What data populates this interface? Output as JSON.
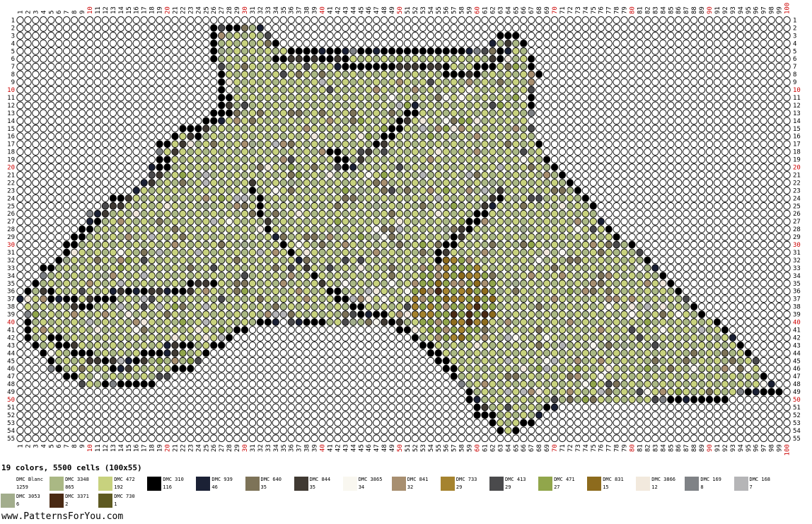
{
  "pattern": {
    "columns": 100,
    "rows": 55,
    "summary": "19 colors, 5500 cells (100x55)",
    "website": "www.PatternsForYou.com",
    "highlight_color": "#cc0000",
    "grid_line_color": "#000000"
  },
  "legend": [
    {
      "name": "DMC Blanc",
      "count": "1259",
      "color": "#ffffff"
    },
    {
      "name": "DMC 3348",
      "count": "865",
      "color": "#aab884"
    },
    {
      "name": "DMC 472",
      "count": "192",
      "color": "#c8d27e"
    },
    {
      "name": "DMC 310",
      "count": "116",
      "color": "#000000"
    },
    {
      "name": "DMC 939",
      "count": "46",
      "color": "#1b2135"
    },
    {
      "name": "DMC 640",
      "count": "35",
      "color": "#7d7358"
    },
    {
      "name": "DMC 844",
      "count": "35",
      "color": "#403a33"
    },
    {
      "name": "DMC 3865",
      "count": "34",
      "color": "#f9f7f0"
    },
    {
      "name": "DMC 841",
      "count": "32",
      "color": "#a88f70"
    },
    {
      "name": "DMC 733",
      "count": "29",
      "color": "#a5832f"
    },
    {
      "name": "DMC 413",
      "count": "29",
      "color": "#4a4a4c"
    },
    {
      "name": "DMC 471",
      "count": "27",
      "color": "#91a64b"
    },
    {
      "name": "DMC 831",
      "count": "15",
      "color": "#8d6b1d"
    },
    {
      "name": "DMC 3866",
      "count": "12",
      "color": "#f2e9dd"
    },
    {
      "name": "DMC 169",
      "count": "8",
      "color": "#7f8286"
    },
    {
      "name": "DMC 168",
      "count": "7",
      "color": "#b5b5b7"
    },
    {
      "name": "DMC 3053",
      "count": "6",
      "color": "#a2ad8c"
    },
    {
      "name": "DMC 3371",
      "count": "2",
      "color": "#4a2a14"
    },
    {
      "name": "DMC 730",
      "count": "1",
      "color": "#5e5a22"
    }
  ]
}
